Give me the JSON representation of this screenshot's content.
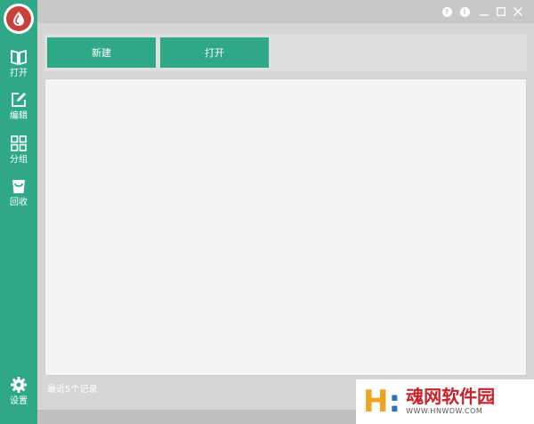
{
  "window": {
    "controls": [
      {
        "name": "help-button",
        "glyph": "?"
      },
      {
        "name": "info-button",
        "glyph": "i"
      },
      {
        "name": "minimize-button",
        "glyph": "—"
      },
      {
        "name": "maximize-button",
        "glyph": "☐"
      },
      {
        "name": "close-button",
        "glyph": "✕"
      }
    ]
  },
  "sidebar": {
    "logo_icon": "blood-drop-icon",
    "items": [
      {
        "label": "打开",
        "icon": "book-open-icon"
      },
      {
        "label": "编辑",
        "icon": "edit-icon"
      },
      {
        "label": "分组",
        "icon": "grid-icon"
      },
      {
        "label": "回收",
        "icon": "recycle-bag-icon"
      }
    ],
    "settings": {
      "label": "设置",
      "icon": "gear-icon"
    }
  },
  "toolbar": {
    "new_label": "新建",
    "open_label": "打开"
  },
  "footer": {
    "recent_label": "最近5个记录"
  },
  "watermark": {
    "title": "魂网软件园",
    "url": "WWW.HNWDW.COM"
  },
  "colors": {
    "accent": "#2ea886",
    "logo_red": "#c9403a",
    "titlebar": "#c8c8c8",
    "list_bg": "#f4f4f4"
  }
}
